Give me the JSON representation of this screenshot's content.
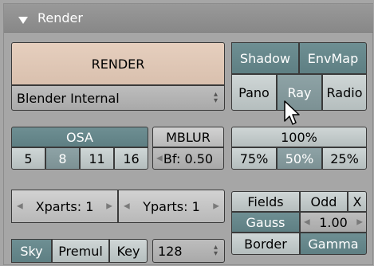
{
  "panel": {
    "title": "Render"
  },
  "render": {
    "button_label": "RENDER",
    "engine_selected": "Blender Internal",
    "engine_icon": "up-down-arrows-icon"
  },
  "shadow_row": {
    "shadow": "Shadow",
    "envmap": "EnvMap"
  },
  "pano_row": {
    "pano": "Pano",
    "ray": "Ray",
    "radio": "Radio"
  },
  "osa": {
    "label": "OSA",
    "levels": [
      "5",
      "8",
      "11",
      "16"
    ],
    "selected": "8"
  },
  "mblur": {
    "label": "MBLUR",
    "bf_value": "Bf: 0.50"
  },
  "size": {
    "label": "100%",
    "options": [
      "75%",
      "50%",
      "25%"
    ],
    "selected": "50%"
  },
  "parts": {
    "xparts": "Xparts: 1",
    "yparts": "Yparts: 1"
  },
  "fields": {
    "fields": "Fields",
    "odd": "Odd",
    "x": "X"
  },
  "filter": {
    "gauss": "Gauss",
    "filter_value": "1.00"
  },
  "border": {
    "border": "Border",
    "gamma": "Gamma"
  },
  "alpha": {
    "sky": "Sky",
    "premul": "Premul",
    "key": "Key",
    "depth_value": "128"
  },
  "colors": {
    "teal": "#6e8f93",
    "light_teal": "#cfd6d6",
    "render_button": "#e6cfbe",
    "panel_bg": "#a6a6a6"
  }
}
